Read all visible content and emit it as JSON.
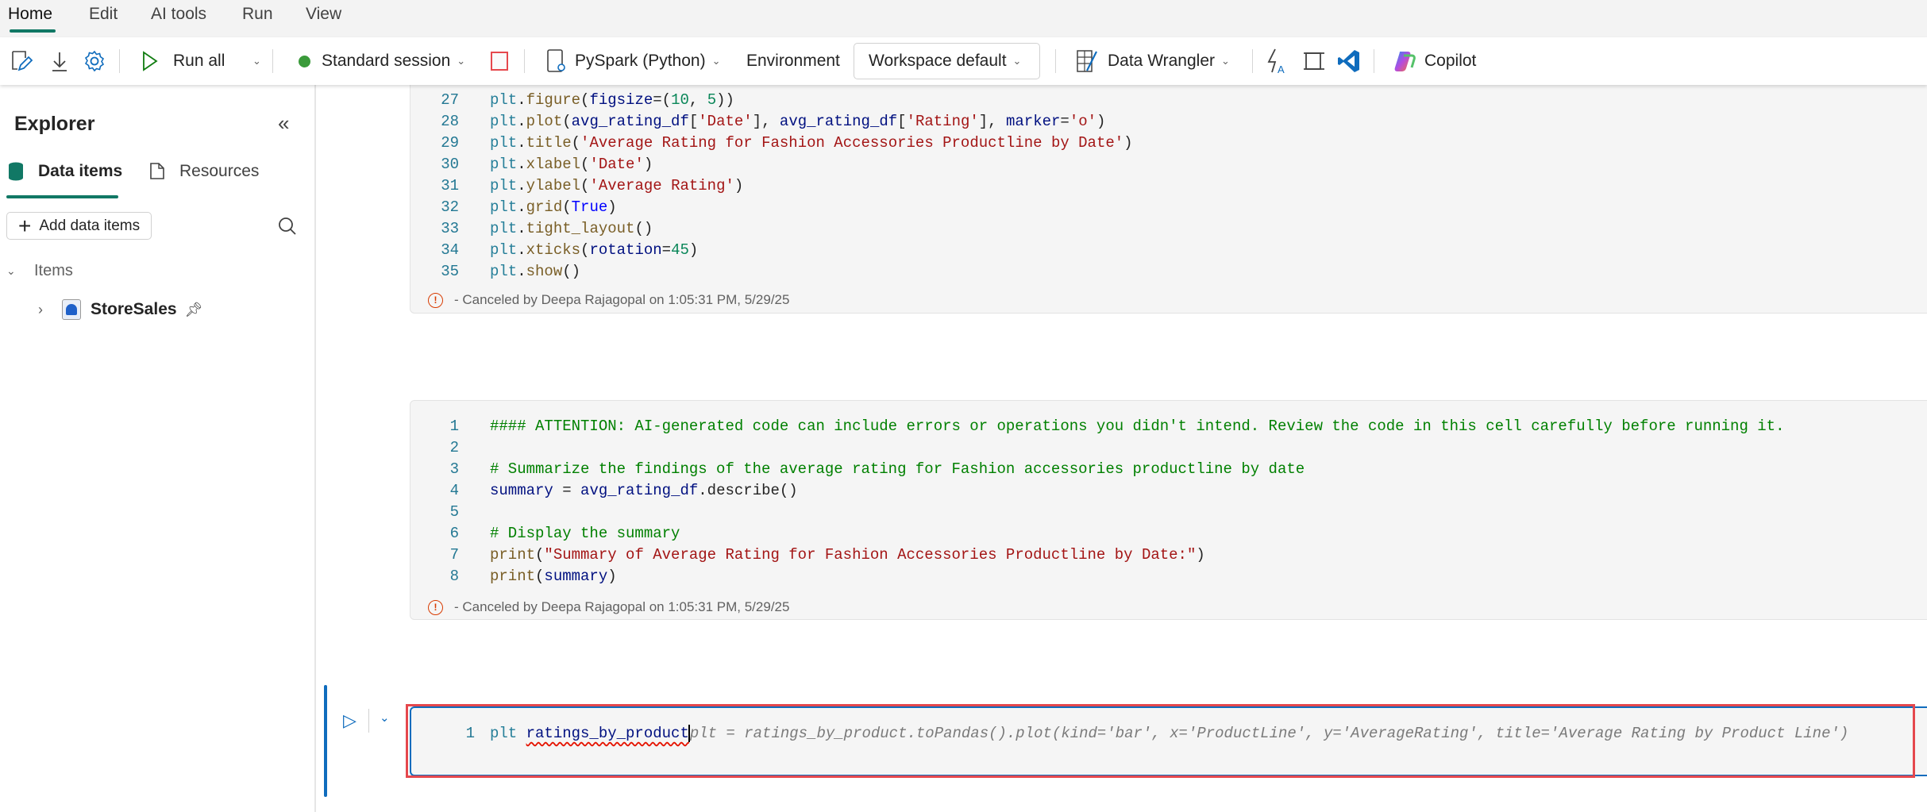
{
  "menu_tabs": [
    {
      "label": "Home",
      "active": true
    },
    {
      "label": "Edit"
    },
    {
      "label": "AI tools"
    },
    {
      "label": "Run"
    },
    {
      "label": "View"
    }
  ],
  "toolbar": {
    "run_all": "Run all",
    "session": "Standard session",
    "language": "PySpark (Python)",
    "environment_label": "Environment",
    "environment_value": "Workspace default",
    "data_wrangler": "Data Wrangler",
    "copilot": "Copilot"
  },
  "sidebar": {
    "title": "Explorer",
    "tabs": [
      {
        "label": "Data items",
        "active": true
      },
      {
        "label": "Resources"
      }
    ],
    "add_button": "Add data items",
    "section": "Items",
    "items": [
      {
        "label": "StoreSales"
      }
    ]
  },
  "colors": {
    "accent": "#117865",
    "selection_box": "#e5484d",
    "active_cell": "#0f6cbd"
  },
  "cells": [
    {
      "lines": [
        {
          "n": "27",
          "tokens": [
            [
              "plt",
              "plt"
            ],
            [
              ".",
              "p"
            ],
            [
              "figure",
              "fn"
            ],
            [
              "(",
              "p"
            ],
            [
              "figsize",
              "var"
            ],
            [
              "=(",
              "p"
            ],
            [
              "10",
              "num"
            ],
            [
              ", ",
              "p"
            ],
            [
              "5",
              "num"
            ],
            [
              "))",
              "p"
            ]
          ]
        },
        {
          "n": "28",
          "tokens": [
            [
              "plt",
              "plt"
            ],
            [
              ".",
              "p"
            ],
            [
              "plot",
              "fn"
            ],
            [
              "(",
              "p"
            ],
            [
              "avg_rating_df",
              "var"
            ],
            [
              "[",
              "p"
            ],
            [
              "'Date'",
              "str"
            ],
            [
              "], ",
              "p"
            ],
            [
              "avg_rating_df",
              "var"
            ],
            [
              "[",
              "p"
            ],
            [
              "'Rating'",
              "str"
            ],
            [
              "], ",
              "p"
            ],
            [
              "marker",
              "var"
            ],
            [
              "=",
              "p"
            ],
            [
              "'o'",
              "str"
            ],
            [
              ")",
              "p"
            ]
          ]
        },
        {
          "n": "29",
          "tokens": [
            [
              "plt",
              "plt"
            ],
            [
              ".",
              "p"
            ],
            [
              "title",
              "fn"
            ],
            [
              "(",
              "p"
            ],
            [
              "'Average Rating for Fashion Accessories Productline by Date'",
              "str"
            ],
            [
              ")",
              "p"
            ]
          ]
        },
        {
          "n": "30",
          "tokens": [
            [
              "plt",
              "plt"
            ],
            [
              ".",
              "p"
            ],
            [
              "xlabel",
              "fn"
            ],
            [
              "(",
              "p"
            ],
            [
              "'Date'",
              "str"
            ],
            [
              ")",
              "p"
            ]
          ]
        },
        {
          "n": "31",
          "tokens": [
            [
              "plt",
              "plt"
            ],
            [
              ".",
              "p"
            ],
            [
              "ylabel",
              "fn"
            ],
            [
              "(",
              "p"
            ],
            [
              "'Average Rating'",
              "str"
            ],
            [
              ")",
              "p"
            ]
          ]
        },
        {
          "n": "32",
          "tokens": [
            [
              "plt",
              "plt"
            ],
            [
              ".",
              "p"
            ],
            [
              "grid",
              "fn"
            ],
            [
              "(",
              "p"
            ],
            [
              "True",
              "kw"
            ],
            [
              ")",
              "p"
            ]
          ]
        },
        {
          "n": "33",
          "tokens": [
            [
              "plt",
              "plt"
            ],
            [
              ".",
              "p"
            ],
            [
              "tight_layout",
              "fn"
            ],
            [
              "()",
              "p"
            ]
          ]
        },
        {
          "n": "34",
          "tokens": [
            [
              "plt",
              "plt"
            ],
            [
              ".",
              "p"
            ],
            [
              "xticks",
              "fn"
            ],
            [
              "(",
              "p"
            ],
            [
              "rotation",
              "var"
            ],
            [
              "=",
              "p"
            ],
            [
              "45",
              "num"
            ],
            [
              ")",
              "p"
            ]
          ]
        },
        {
          "n": "35",
          "tokens": [
            [
              "plt",
              "plt"
            ],
            [
              ".",
              "p"
            ],
            [
              "show",
              "fn"
            ],
            [
              "()",
              "p"
            ]
          ]
        }
      ],
      "status": "- Canceled by Deepa Rajagopal on 1:05:31 PM, 5/29/25"
    },
    {
      "lines": [
        {
          "n": "1",
          "tokens": [
            [
              "#### ATTENTION: AI-generated code can include errors or operations you didn't intend. Review the code in this cell carefully before running it.",
              "com"
            ]
          ]
        },
        {
          "n": "2",
          "tokens": []
        },
        {
          "n": "3",
          "tokens": [
            [
              "# Summarize the findings of the average rating for Fashion accessories productline by date",
              "com"
            ]
          ]
        },
        {
          "n": "4",
          "tokens": [
            [
              "summary",
              "var"
            ],
            [
              " = ",
              "p"
            ],
            [
              "avg_rating_df",
              "var"
            ],
            [
              ".describe()",
              "p"
            ]
          ]
        },
        {
          "n": "5",
          "tokens": []
        },
        {
          "n": "6",
          "tokens": [
            [
              "# Display the summary",
              "com"
            ]
          ]
        },
        {
          "n": "7",
          "tokens": [
            [
              "print",
              "fn"
            ],
            [
              "(",
              "p"
            ],
            [
              "\"Summary of Average Rating for Fashion Accessories Productline by Date:\"",
              "str"
            ],
            [
              ")",
              "p"
            ]
          ]
        },
        {
          "n": "8",
          "tokens": [
            [
              "print",
              "fn"
            ],
            [
              "(",
              "p"
            ],
            [
              "summary",
              "var"
            ],
            [
              ")",
              "p"
            ]
          ]
        }
      ],
      "status": "- Canceled by Deepa Rajagopal on 1:05:31 PM, 5/29/25"
    },
    {
      "lines": [
        {
          "n": "1",
          "typed_prefix": "plt ",
          "typed_error": "ratings_by_product",
          "suggestion": "plt = ratings_by_product.toPandas().plot(kind='bar', x='ProductLine', y='AverageRating', title='Average Rating by Product Line')"
        }
      ]
    }
  ]
}
